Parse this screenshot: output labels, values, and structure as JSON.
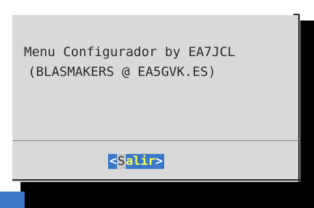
{
  "dialog": {
    "line1": "Menu Configurador by EA7JCL",
    "line2": "(BLASMAKERS @ EA5GVK.ES)"
  },
  "button": {
    "open_bracket": "<",
    "hotkey": "S",
    "rest": "alir",
    "close_bracket": ">"
  },
  "colors": {
    "dialog_bg": "#d9d9d9",
    "button_bg": "#3a78c9",
    "button_text": "#ffff55",
    "shadow": "#000000"
  }
}
